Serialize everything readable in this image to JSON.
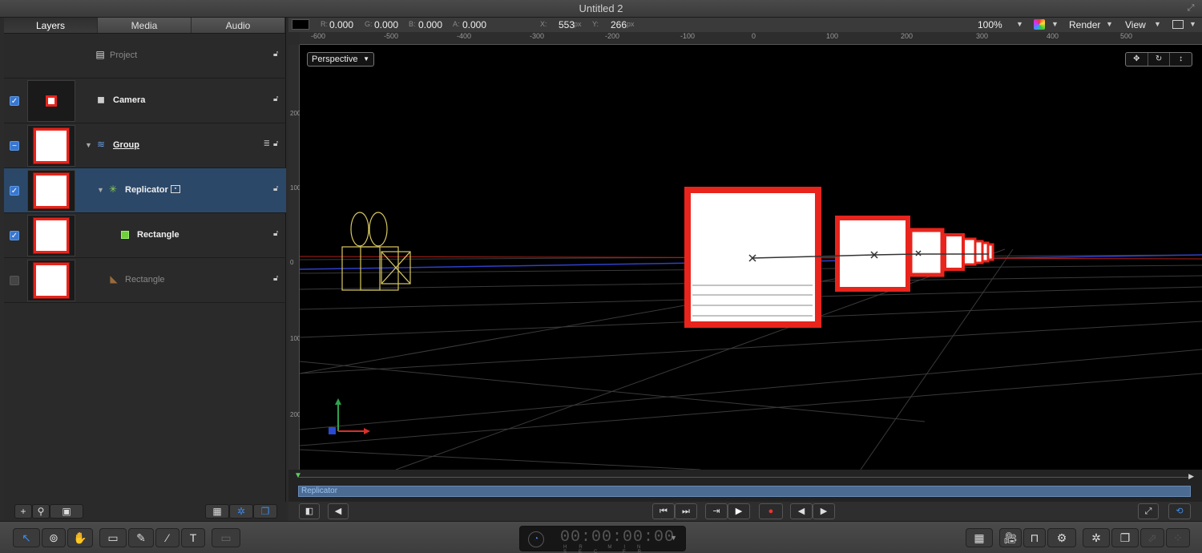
{
  "window": {
    "title": "Untitled 2"
  },
  "tabs": [
    "Layers",
    "Media",
    "Audio"
  ],
  "layers": [
    {
      "name": "Project",
      "icon": "document-icon",
      "checked": null,
      "dim": true
    },
    {
      "name": "Camera",
      "icon": "camera-icon",
      "checked": true,
      "dim": false
    },
    {
      "name": "Group",
      "icon": "group-icon",
      "checked": "mixed",
      "dim": false
    },
    {
      "name": "Replicator",
      "icon": "replicator-icon",
      "checked": true,
      "dim": false
    },
    {
      "name": "Rectangle",
      "icon": "rectangle-icon",
      "checked": true,
      "dim": false
    },
    {
      "name": "Rectangle",
      "icon": "rectangle-icon",
      "checked": false,
      "dim": true
    }
  ],
  "color_info": {
    "r_label": "R:",
    "r": "0.000",
    "g_label": "G:",
    "g": "0.000",
    "b_label": "B:",
    "b": "0.000",
    "a_label": "A:",
    "a": "0.000",
    "x_label": "X:",
    "x": "553",
    "x_unit": "px",
    "y_label": "Y:",
    "y": "266",
    "y_unit": "px"
  },
  "view_controls": {
    "zoom": "100%",
    "render": "Render",
    "view": "View"
  },
  "ruler": [
    "-600",
    "-500",
    "-400",
    "-300",
    "-200",
    "-100",
    "0",
    "100",
    "200",
    "300",
    "400",
    "500"
  ],
  "vruler": [
    "200",
    "100",
    "0",
    "100",
    "200"
  ],
  "canvas": {
    "camera_view": "Perspective"
  },
  "timeline": {
    "clip_label": "Replicator"
  },
  "timecode": {
    "value": "00:00:00:00",
    "units": "HR MIN SEC FR"
  },
  "colors": {
    "accent": "#3a76d0",
    "selection": "#2c4868",
    "clip": "#4b6b93",
    "shape_border": "#e8241c"
  }
}
